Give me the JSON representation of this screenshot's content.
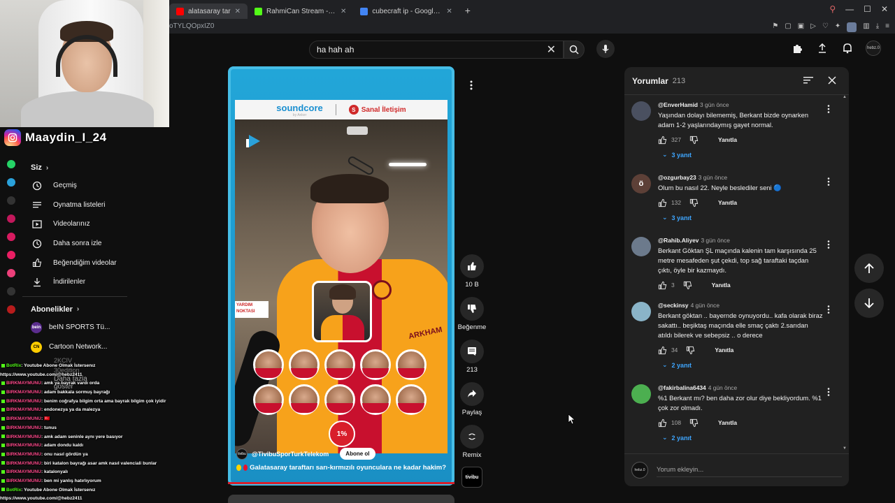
{
  "browser": {
    "tabs": [
      {
        "title": "alatasaray tar",
        "favicon_color": "#ff0000",
        "active": true
      },
      {
        "title": "RahmiCan Stream - Watc",
        "favicon_color": "#53fc18",
        "active": false
      },
      {
        "title": "cubecraft ip - Google'da",
        "favicon_color": "#4285f4",
        "active": false
      }
    ],
    "new_tab": "+",
    "url": "oTYLQOpxIZ0"
  },
  "header": {
    "search_value": "ha hah ah",
    "avatar_text": "hebz.0"
  },
  "overlay": {
    "instagram_handle": "Maaydin_I_24"
  },
  "guide": {
    "you_label": "Siz",
    "items": [
      {
        "label": "Geçmiş",
        "icon": "history-icon"
      },
      {
        "label": "Oynatma listeleri",
        "icon": "playlist-icon"
      },
      {
        "label": "Videolarınız",
        "icon": "video-icon"
      },
      {
        "label": "Daha sonra izle",
        "icon": "clock-icon"
      },
      {
        "label": "Beğendiğim videolar",
        "icon": "thumb-up-icon"
      },
      {
        "label": "İndirilenler",
        "icon": "download-icon"
      }
    ],
    "subs_label": "Abonelikler",
    "subs": [
      {
        "name": "beIN SPORTS Tü...",
        "color": "#5b2d8e",
        "abbr": "bein"
      },
      {
        "name": "Cartoon Network...",
        "color": "#ffcc00",
        "abbr": "CN"
      }
    ],
    "more_label": "Daha fazla göster",
    "dim_items": [
      "2KCIV",
      "30edition"
    ]
  },
  "chat": [
    {
      "user": "BotRix",
      "msg": ": Youtube Abone Olmak İstersenız",
      "bot": true
    },
    {
      "user": "",
      "msg": "https://www.youtube.com/@hebz2411",
      "bot": false,
      "plain": true
    },
    {
      "user": "BIRKMAYMUNU",
      "msg": ": amk ya bayrak vardı orda",
      "bot": false
    },
    {
      "user": "BIRKMAYMUNU",
      "msg": ": adam bakkala sormuş bayrağı",
      "bot": false
    },
    {
      "user": "BIRKMAYMUNU",
      "msg": ": benim coğrafya bilgim orta ama bayrak bilgim çok iyidir",
      "bot": false
    },
    {
      "user": "BIRKMAYMUNU",
      "msg": ": endonezya ya da malezya",
      "bot": false
    },
    {
      "user": "BIRKMAYMUNU",
      "msg": ": 🇹🇷",
      "bot": false
    },
    {
      "user": "BIRKMAYMUNU",
      "msg": ": tunus",
      "bot": false
    },
    {
      "user": "BIRKMAYMUNU",
      "msg": ": amk adam seninle aynı yere basıyor",
      "bot": false
    },
    {
      "user": "BIRKMAYMUNU",
      "msg": ": adam dondu kaldı",
      "bot": false
    },
    {
      "user": "BIRKMAYMUNU",
      "msg": ": onu nasıl gördün ya",
      "bot": false
    },
    {
      "user": "BIRKMAYMUNU",
      "msg": ": biri katalon bayrağı asar amk nasıl valenciali bunlar",
      "bot": false
    },
    {
      "user": "BIRKMAYMUNU",
      "msg": ": katalonyalı",
      "bot": false
    },
    {
      "user": "BIRKMAYMUNU",
      "msg": ": ben mi yanlış hatırlıyorum",
      "bot": false
    },
    {
      "user": "BotRix",
      "msg": ": Youtube Abone Olmak İstersenız",
      "bot": true
    },
    {
      "user": "",
      "msg": "https://www.youtube.com/@hebz2411",
      "bot": false,
      "plain": true
    }
  ],
  "short": {
    "sponsor_a": "soundcore",
    "sponsor_a_sub": "by Anker",
    "sponsor_b": "Sanal İletişim",
    "sign_text": "YARDIM NOKTASI",
    "jersey_text": "ARKHAM",
    "poll_percent": "1%",
    "channel": "@TivibuSporTurkTelekom",
    "channel_avatar": "tivibu",
    "subscribe": "Abone ol",
    "title": "Galatasaray taraftarı sarı-kırmızılı oyunculara ne kadar hakim?",
    "progress_fraction": 1.0
  },
  "actions": {
    "likes": "10 B",
    "dislike": "Beğenme",
    "comments": "213",
    "share": "Paylaş",
    "remix": "Remix",
    "remix_thumb": "tivibu"
  },
  "comments": {
    "title": "Yorumlar",
    "count": "213",
    "input_placeholder": "Yorum ekleyin...",
    "my_avatar": "hebz.0",
    "reply_label": "Yanıtla",
    "items": [
      {
        "author": "@EnverHamid",
        "time": "3 gün önce",
        "text": "Yaşından dolayı bilememiş, Berkant bizde oynarken adam 1-2 yaşlarındaymış gayet normal.",
        "likes": "327",
        "replies": "3 yanıt",
        "avatar_color": "#4a5060",
        "avatar_letter": ""
      },
      {
        "author": "@ozgurbay23",
        "time": "3 gün önce",
        "text": "Olum bu nasıl 22. Neyle beslediler seni 🔵",
        "likes": "132",
        "replies": "3 yanıt",
        "avatar_color": "#5d4037",
        "avatar_letter": "ö"
      },
      {
        "author": "@Rahib.Aliyev",
        "time": "3 gün önce",
        "text": "Berkant Göktan ŞL maçında kalenin tam karşısında 25 metre mesafeden şut çekdi, top sağ taraftaki taçdan çıktı, öyle bir kazmaydı.",
        "likes": "3",
        "replies": "",
        "avatar_color": "#6c7a8c",
        "avatar_letter": ""
      },
      {
        "author": "@seckinsy",
        "time": "4 gün önce",
        "text": "Berkant göktan .. bayernde oynuyordu.. kafa olarak biraz sakattı.. beşiktaş maçında elle smaç çaktı 2.sarıdan atıldı bilerek ve sebepsiz .. o derece",
        "likes": "34",
        "replies": "2 yanıt",
        "avatar_color": "#8ab4c8",
        "avatar_letter": ""
      },
      {
        "author": "@fakirbalina6434",
        "time": "4 gün önce",
        "text": "%1 Berkant mı? ben daha zor olur diye bekliyordum. %1 çok zor olmadı.",
        "likes": "108",
        "replies": "2 yanıt",
        "avatar_color": "#4caf50",
        "avatar_letter": ""
      }
    ]
  },
  "colors": {
    "accent_red": "#d81e2b",
    "link_blue": "#3ea6ff",
    "kick_green": "#53fc18"
  }
}
